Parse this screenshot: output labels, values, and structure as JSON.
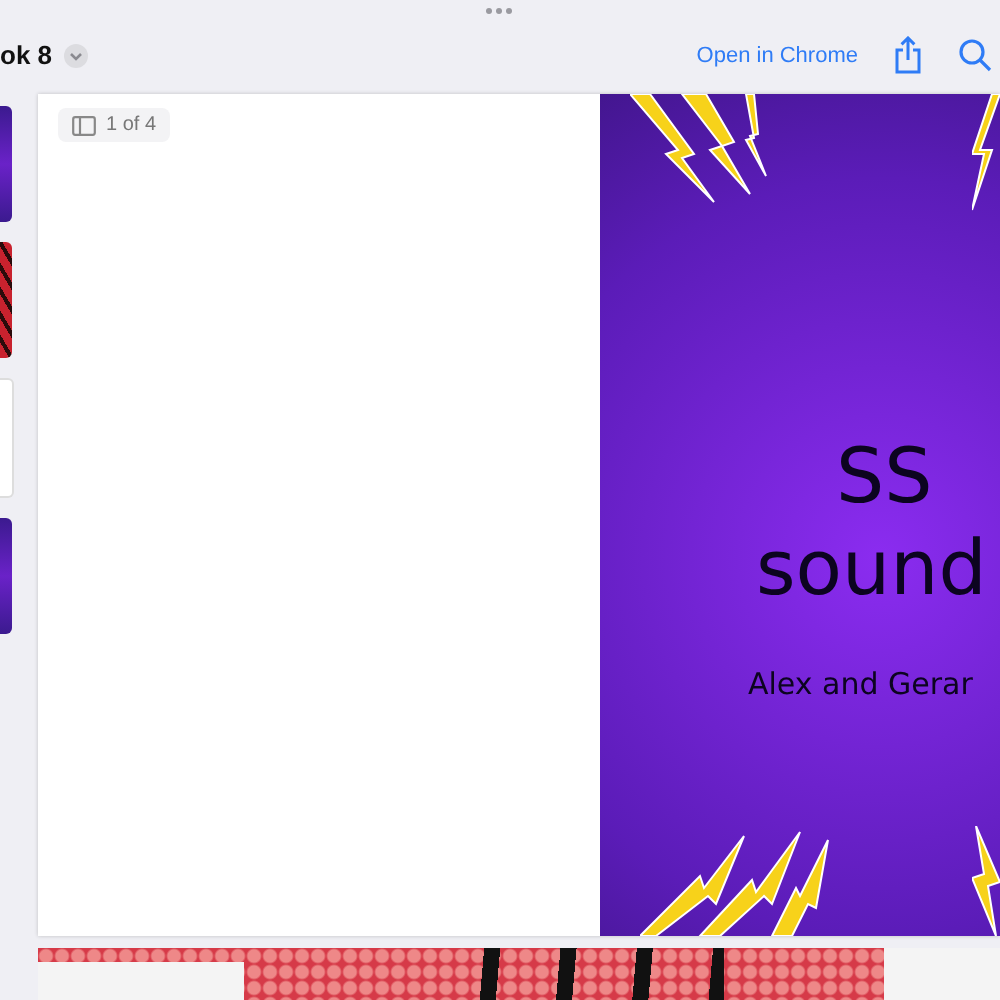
{
  "toolbar": {
    "title": "ok 8",
    "open_link": "Open in Chrome"
  },
  "thumbnails": [
    {
      "kind": "purple"
    },
    {
      "kind": "red"
    },
    {
      "kind": "blank"
    },
    {
      "kind": "purple"
    }
  ],
  "page": {
    "counter": "1 of 4",
    "slide": {
      "title_lines": [
        "SS",
        "sound"
      ],
      "subtitle": "Alex and Gerar"
    }
  }
}
